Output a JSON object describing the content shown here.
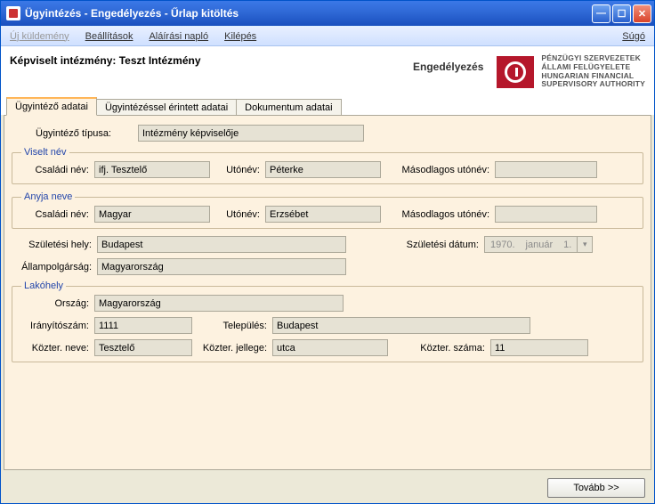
{
  "titlebar": {
    "title": "Ügyintézés - Engedélyezés - Űrlap kitöltés"
  },
  "menu": {
    "new_send": "Új küldemény",
    "settings": "Beállítások",
    "sign_log": "Aláírási napló",
    "exit": "Kilépés",
    "help": "Súgó"
  },
  "header": {
    "rep_inst_label": "Képviselt intézmény:",
    "rep_inst_value": "Teszt Intézmény",
    "mid_title": "Engedélyezés",
    "logo_lines": {
      "l1": "PÉNZÜGYI SZERVEZETEK",
      "l2": "ÁLLAMI FELÜGYELETE",
      "l3": "HUNGARIAN FINANCIAL",
      "l4": "SUPERVISORY AUTHORITY"
    }
  },
  "tabs": {
    "t1": "Ügyintéző adatai",
    "t2": "Ügyintézéssel érintett adatai",
    "t3": "Dokumentum adatai"
  },
  "form": {
    "type_label": "Ügyintéző típusa:",
    "type_value": "Intézmény képviselője",
    "group_name": "Viselt név",
    "group_mother": "Anyja neve",
    "group_addr": "Lakóhely",
    "family_label": "Családi név:",
    "given_label": "Utónév:",
    "second_given_label": "Másodlagos utónév:",
    "name": {
      "family": "ifj. Tesztelő",
      "given": "Péterke",
      "second": ""
    },
    "mother": {
      "family": "Magyar",
      "given": "Erzsébet",
      "second": ""
    },
    "birth_place_label": "Születési hely:",
    "birth_place": "Budapest",
    "birth_date_label": "Születési dátum:",
    "birth_date": {
      "year": "1970.",
      "month": "január",
      "day": "1."
    },
    "citizenship_label": "Állampolgárság:",
    "citizenship": "Magyarország",
    "country_label": "Ország:",
    "country": "Magyarország",
    "zip_label": "Irányítószám:",
    "zip": "1111",
    "city_label": "Település:",
    "city": "Budapest",
    "street_label": "Közter. neve:",
    "street": "Tesztelő",
    "street_type_label": "Közter. jellege:",
    "street_type": "utca",
    "street_no_label": "Közter. száma:",
    "street_no": "11"
  },
  "footer": {
    "next": "Tovább >>"
  }
}
